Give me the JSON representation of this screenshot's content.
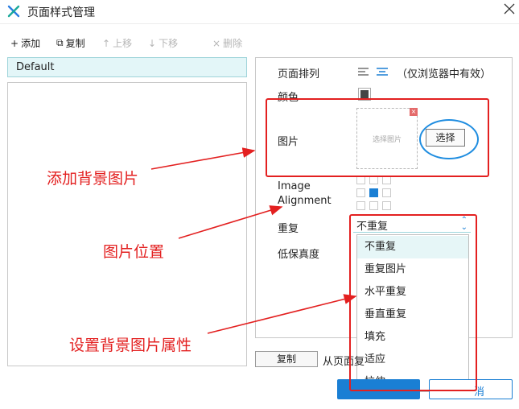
{
  "window": {
    "title": "页面样式管理",
    "logo_icon": "axure-x-icon",
    "close_icon": "close-icon"
  },
  "toolbar": {
    "add_label": "添加",
    "copy_label": "复制",
    "move_up_label": "上移",
    "move_down_label": "下移",
    "delete_label": "删除",
    "add_glyph": "+",
    "copy_glyph": "⧉",
    "up_glyph": "↑",
    "down_glyph": "↓",
    "delete_glyph": "×"
  },
  "style_list": {
    "items": [
      "Default"
    ],
    "selected": "Default"
  },
  "properties": {
    "page_align_label": "页面排列",
    "page_align_note": "（仅浏览器中有效）",
    "color_label": "颜色",
    "color_value": "#444444",
    "image_label": "图片",
    "image_placeholder": "选择图片",
    "choose_button": "选择",
    "image_alignment_label_1": "Image",
    "image_alignment_label_2": "Alignment",
    "image_alignment_selected": "center",
    "repeat_label": "重复",
    "repeat_value": "不重复",
    "low_fidelity_label": "低保真度",
    "repeat_options": [
      "不重复",
      "重复图片",
      "水平重复",
      "垂直重复",
      "填充",
      "适应",
      "拉伸"
    ]
  },
  "bottom": {
    "copy_button": "复制",
    "from_text": "从页面复"
  },
  "dialog_buttons": {
    "ok": "",
    "cancel": "消"
  },
  "annotations": {
    "add_bg_image": "添加背景图片",
    "image_position": "图片位置",
    "set_bg_image_props": "设置背景图片属性"
  },
  "colors": {
    "accent": "#1a7fd4",
    "annotation_red": "#e32020",
    "annotation_blue": "#1f8de0",
    "selection_bg": "#e3f6f8"
  }
}
